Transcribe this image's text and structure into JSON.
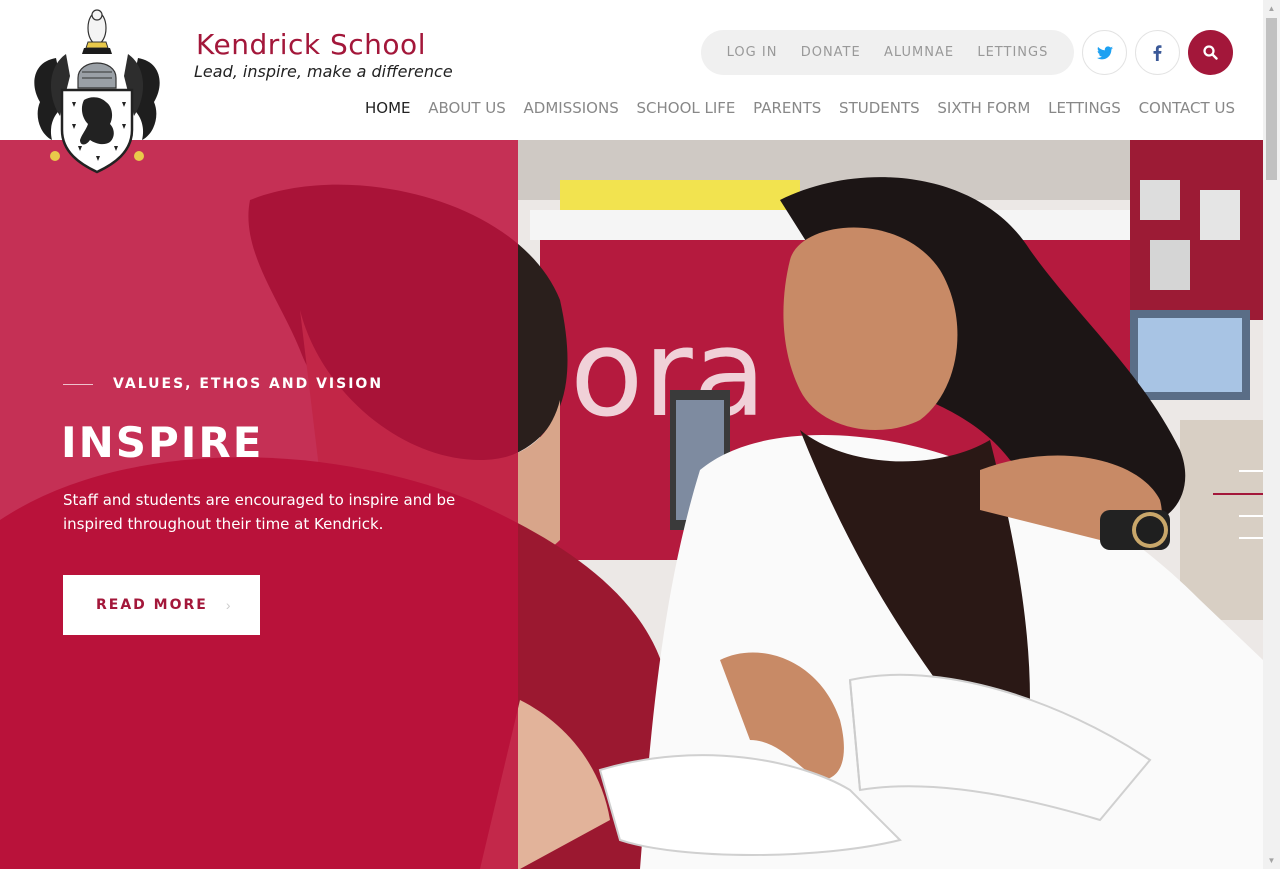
{
  "brand": {
    "name": "Kendrick School",
    "tagline": "Lead, inspire, make a difference"
  },
  "utility_nav": [
    "LOG IN",
    "DONATE",
    "ALUMNAE",
    "LETTINGS"
  ],
  "social": {
    "twitter_icon": "twitter-icon",
    "facebook_icon": "facebook-icon",
    "search_icon": "search-icon"
  },
  "main_nav": [
    {
      "label": "HOME",
      "active": true
    },
    {
      "label": "ABOUT US",
      "active": false
    },
    {
      "label": "ADMISSIONS",
      "active": false
    },
    {
      "label": "SCHOOL LIFE",
      "active": false
    },
    {
      "label": "PARENTS",
      "active": false
    },
    {
      "label": "STUDENTS",
      "active": false
    },
    {
      "label": "SIXTH FORM",
      "active": false
    },
    {
      "label": "LETTINGS",
      "active": false
    },
    {
      "label": "CONTACT US",
      "active": false
    }
  ],
  "hero": {
    "eyebrow": "VALUES, ETHOS AND VISION",
    "title": "INSPIRE",
    "body": "Staff and students are encouraged to inspire and be inspired throughout their time at Kendrick.",
    "cta_label": "READ MORE",
    "cta_icon": "chevron-right-icon",
    "slide_count": 4,
    "active_slide": 2
  },
  "colors": {
    "brand": "#a3173a",
    "overlay": "#be123c",
    "text_muted": "#888888",
    "text_dark": "#222222"
  }
}
